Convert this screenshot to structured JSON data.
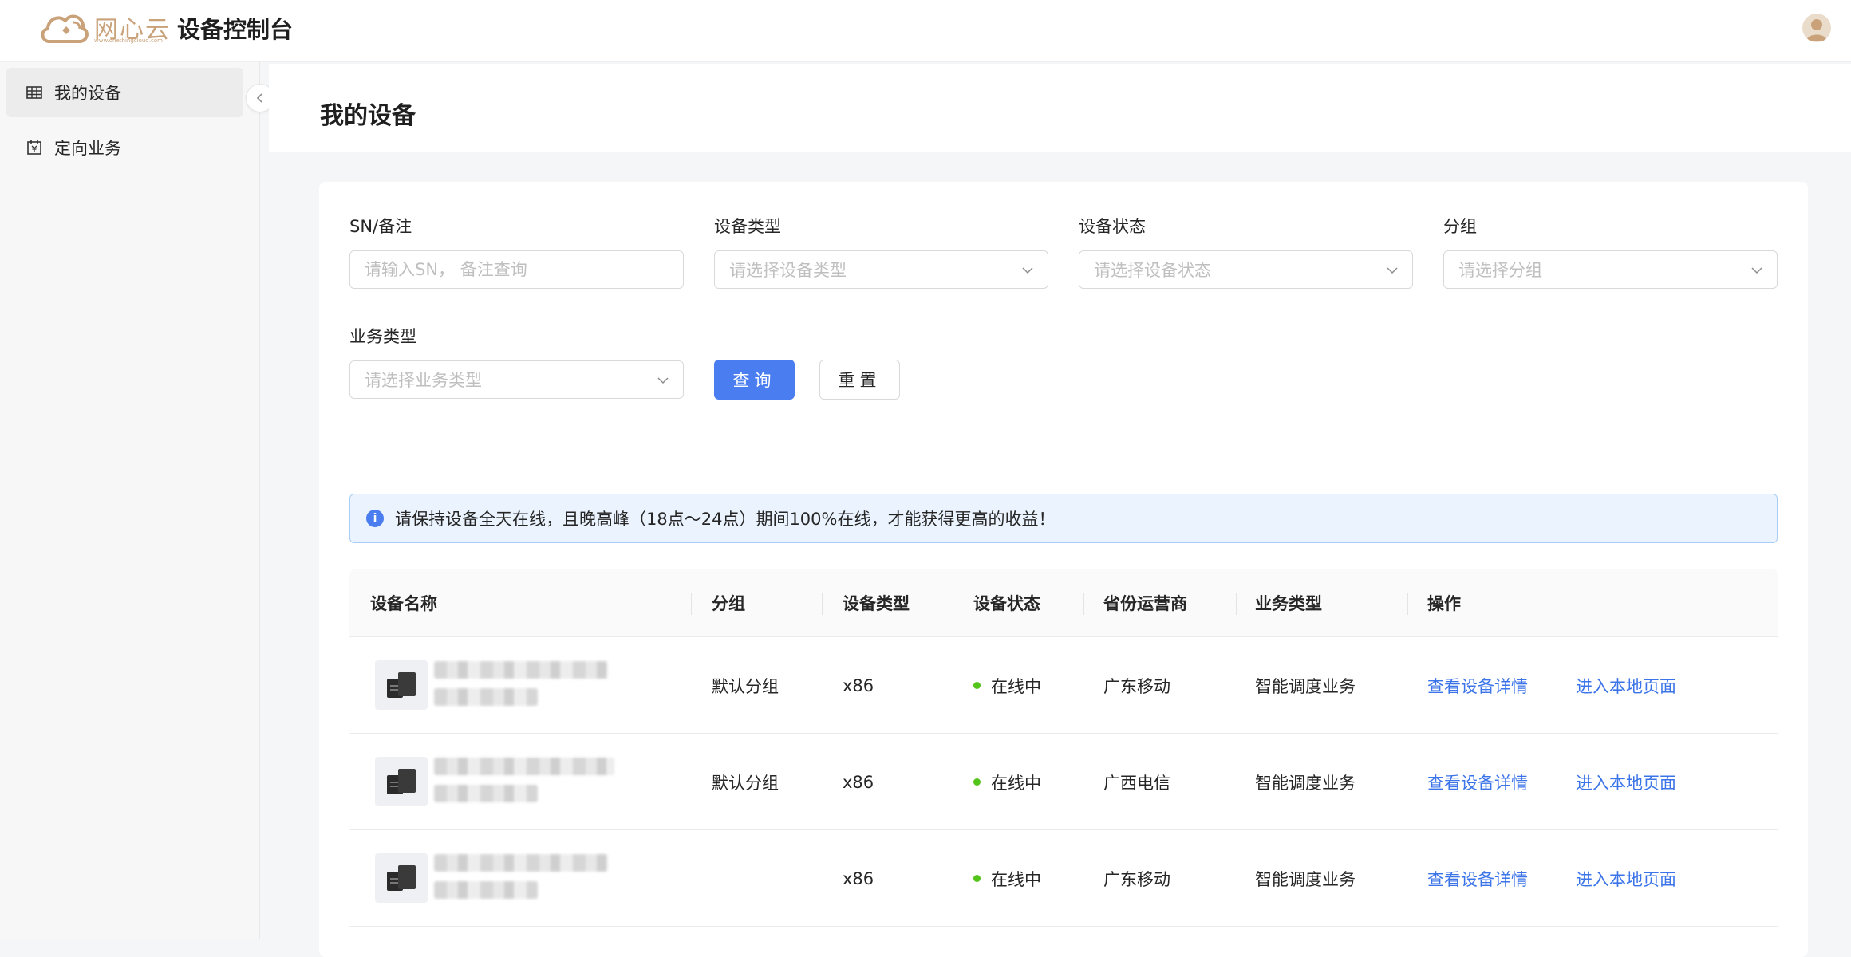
{
  "header": {
    "brand": "网心云",
    "brand_sub": "www.onethingcloud.com",
    "console_title": "设备控制台"
  },
  "sidebar": {
    "items": [
      {
        "label": "我的设备",
        "icon": "table-grid-icon",
        "active": true
      },
      {
        "label": "定向业务",
        "icon": "yen-calendar-icon",
        "active": false
      }
    ]
  },
  "page": {
    "title": "我的设备"
  },
  "filters": {
    "sn": {
      "label": "SN/备注",
      "placeholder": "请输入SN， 备注查询"
    },
    "device_type": {
      "label": "设备类型",
      "placeholder": "请选择设备类型"
    },
    "device_status": {
      "label": "设备状态",
      "placeholder": "请选择设备状态"
    },
    "group": {
      "label": "分组",
      "placeholder": "请选择分组"
    },
    "business_type": {
      "label": "业务类型",
      "placeholder": "请选择业务类型"
    },
    "query_label": "查询",
    "reset_label": "重置"
  },
  "alert": {
    "text": "请保持设备全天在线，且晚高峰（18点～24点）期间100%在线，才能获得更高的收益！"
  },
  "table": {
    "columns": [
      "设备名称",
      "分组",
      "设备类型",
      "设备状态",
      "省份运营商",
      "业务类型",
      "操作"
    ],
    "rows": [
      {
        "group": "默认分组",
        "type": "x86",
        "status": "在线中",
        "isp": "广东移动",
        "business": "智能调度业务",
        "action1": "查看设备详情",
        "action2": "进入本地页面"
      },
      {
        "group": "默认分组",
        "type": "x86",
        "status": "在线中",
        "isp": "广西电信",
        "business": "智能调度业务",
        "action1": "查看设备详情",
        "action2": "进入本地页面"
      },
      {
        "group": "",
        "type": "x86",
        "status": "在线中",
        "isp": "广东移动",
        "business": "智能调度业务",
        "action1": "查看设备详情",
        "action2": "进入本地页面"
      }
    ]
  },
  "colors": {
    "primary": "#4a7df0",
    "link": "#3b74e8",
    "online": "#52c41a",
    "brand": "#c9a27a"
  }
}
